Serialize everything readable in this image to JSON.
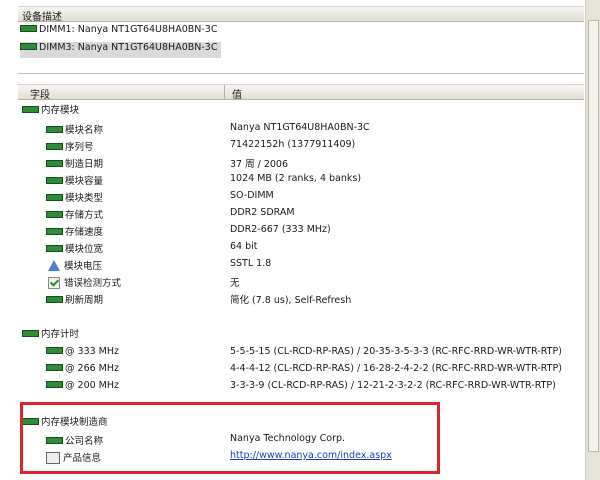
{
  "device_panel": {
    "header": "设备描述",
    "items": [
      "DIMM1: Nanya NT1GT64U8HA0BN-3C",
      "DIMM3: Nanya NT1GT64U8HA0BN-3C"
    ]
  },
  "table": {
    "col_field": "字段",
    "col_value": "值"
  },
  "module_group": {
    "title": "内存模块",
    "rows": [
      {
        "field": "模块名称",
        "value": "Nanya NT1GT64U8HA0BN-3C"
      },
      {
        "field": "序列号",
        "value": "71422152h (1377911409)"
      },
      {
        "field": "制造日期",
        "value": "37 周 / 2006"
      },
      {
        "field": "模块容量",
        "value": "1024 MB (2 ranks, 4 banks)"
      },
      {
        "field": "模块类型",
        "value": "SO-DIMM"
      },
      {
        "field": "存储方式",
        "value": "DDR2 SDRAM"
      },
      {
        "field": "存储速度",
        "value": "DDR2-667 (333 MHz)"
      },
      {
        "field": "模块位宽",
        "value": "64 bit"
      },
      {
        "field": "模块电压",
        "value": "SSTL 1.8"
      },
      {
        "field": "错误检测方式",
        "value": "无"
      },
      {
        "field": "刷新周期",
        "value": "简化 (7.8 us), Self-Refresh"
      }
    ]
  },
  "timing_group": {
    "title": "内存计时",
    "rows": [
      {
        "field": "@ 333 MHz",
        "value": "5-5-5-15  (CL-RCD-RP-RAS) / 20-35-3-5-3-3  (RC-RFC-RRD-WR-WTR-RTP)"
      },
      {
        "field": "@ 266 MHz",
        "value": "4-4-4-12  (CL-RCD-RP-RAS) / 16-28-2-4-2-2  (RC-RFC-RRD-WR-WTR-RTP)"
      },
      {
        "field": "@ 200 MHz",
        "value": "3-3-3-9  (CL-RCD-RP-RAS) / 12-21-2-3-2-2  (RC-RFC-RRD-WR-WTR-RTP)"
      }
    ]
  },
  "maker_group": {
    "title": "内存模块制造商",
    "rows": [
      {
        "field": "公司名称",
        "value": "Nanya Technology Corp."
      },
      {
        "field": "产品信息",
        "value": "http://www.nanya.com/index.aspx"
      }
    ]
  },
  "icons": [
    "memory-chip-icon",
    "voltage-warning-icon",
    "check-icon",
    "document-icon"
  ],
  "colors": {
    "highlight": "#d9262a",
    "chip": "#2f8a3a",
    "link": "#1a3fbf"
  }
}
